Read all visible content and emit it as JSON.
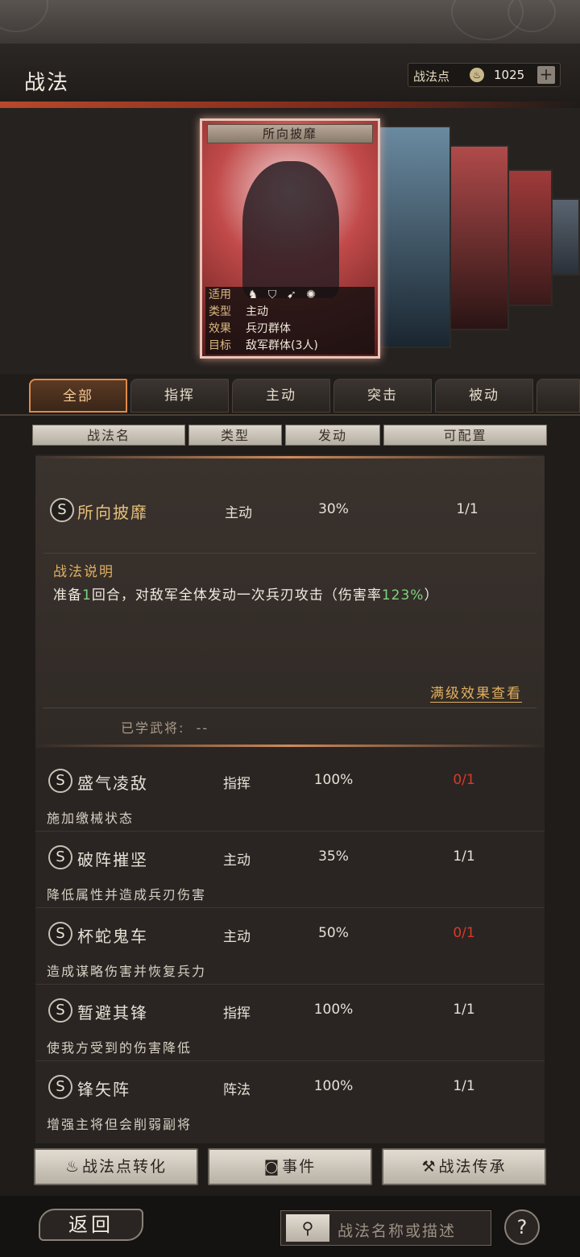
{
  "header": {
    "title": "战法"
  },
  "points": {
    "label": "战法点",
    "icon": "flame-icon",
    "value": "1025",
    "add": "+"
  },
  "card": {
    "name": "所向披靡",
    "rows": [
      {
        "key": "适用",
        "icons": [
          "cavalry-icon",
          "shield-icon",
          "bow-icon",
          "wheel-icon"
        ]
      },
      {
        "key": "类型",
        "value": "主动"
      },
      {
        "key": "效果",
        "value": "兵刃群体"
      },
      {
        "key": "目标",
        "value": "敌军群体(3人)"
      }
    ]
  },
  "tabs": [
    "全部",
    "指挥",
    "主动",
    "突击",
    "被动"
  ],
  "columns": [
    "战法名",
    "类型",
    "发动",
    "可配置"
  ],
  "detail": {
    "grade": "S",
    "name": "所向披靡",
    "type": "主动",
    "rate": "30%",
    "config": "1/1",
    "desc_title": "战法说明",
    "desc_pre": "准备",
    "desc_num1": "1",
    "desc_mid": "回合，对敌军全体发动一次兵刃攻击（伤害率",
    "desc_num2": "123%",
    "desc_post": "）",
    "full_link": "满级效果查看",
    "learned_label": "已学武将:",
    "learned_value": "--"
  },
  "skills": [
    {
      "grade": "S",
      "name": "盛气凌敌",
      "type": "指挥",
      "rate": "100%",
      "config": "0/1",
      "desc": "施加缴械状态"
    },
    {
      "grade": "S",
      "name": "破阵摧坚",
      "type": "主动",
      "rate": "35%",
      "config": "1/1",
      "desc": "降低属性并造成兵刃伤害"
    },
    {
      "grade": "S",
      "name": "杯蛇鬼车",
      "type": "主动",
      "rate": "50%",
      "config": "0/1",
      "desc": "造成谋略伤害并恢复兵力"
    },
    {
      "grade": "S",
      "name": "暂避其锋",
      "type": "指挥",
      "rate": "100%",
      "config": "1/1",
      "desc": "使我方受到的伤害降低"
    },
    {
      "grade": "S",
      "name": "锋矢阵",
      "type": "阵法",
      "rate": "100%",
      "config": "1/1",
      "desc": "增强主将但会削弱副将"
    }
  ],
  "buttons": {
    "convert": "战法点转化",
    "event": "事件",
    "inherit": "战法传承"
  },
  "footer": {
    "back": "返回",
    "search_placeholder": "战法名称或描述",
    "help": "?"
  },
  "colors": {
    "accent": "#e08a4a",
    "gold": "#e0b060",
    "red": "#d83a2a",
    "green": "#7fd27f"
  }
}
